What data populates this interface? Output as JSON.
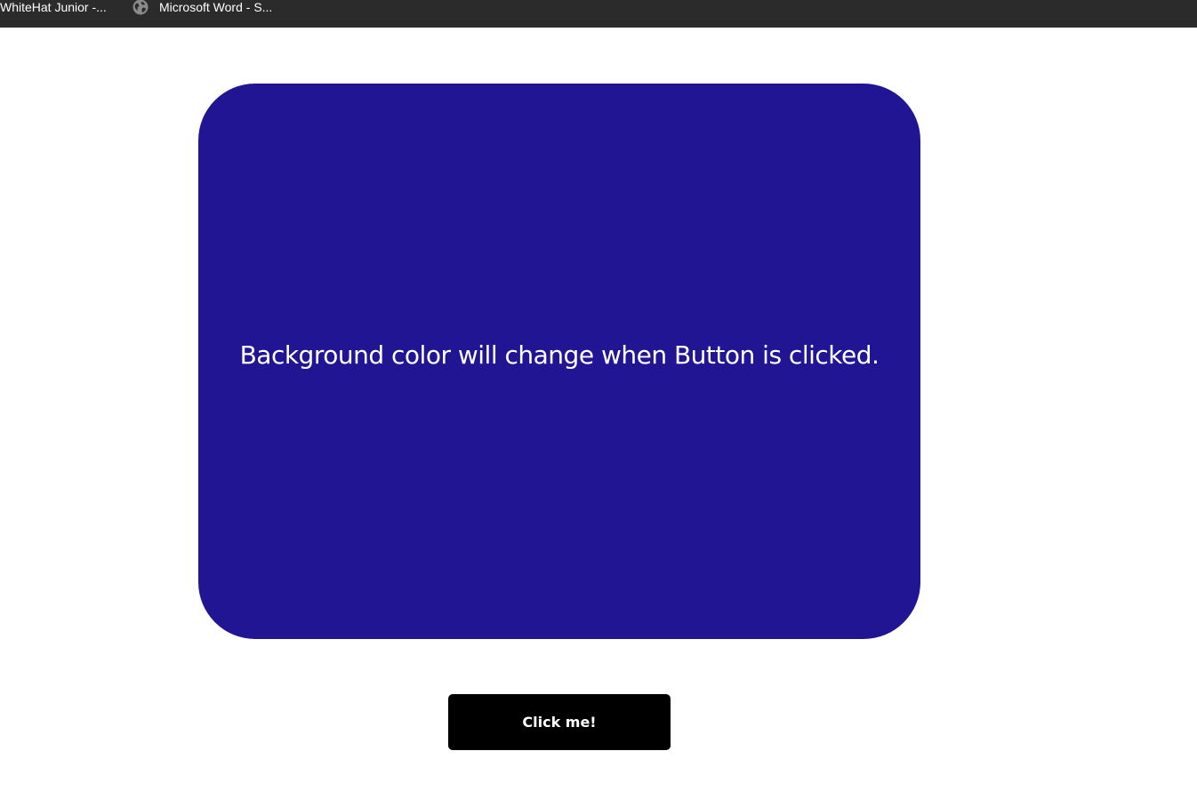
{
  "bookmarks": [
    {
      "label": "WhiteHat Junior -...",
      "icon": "none"
    },
    {
      "label": "Microsoft Word - S...",
      "icon": "globe-icon"
    }
  ],
  "colors": {
    "bookmarks_bar": "#2b2b2b",
    "box_background": "#221593",
    "box_text": "#ffffff",
    "button_background": "#000000",
    "button_text": "#ffffff"
  },
  "main": {
    "box_message": "Background color will change when Button is clicked.",
    "button_label": "Click me!"
  }
}
